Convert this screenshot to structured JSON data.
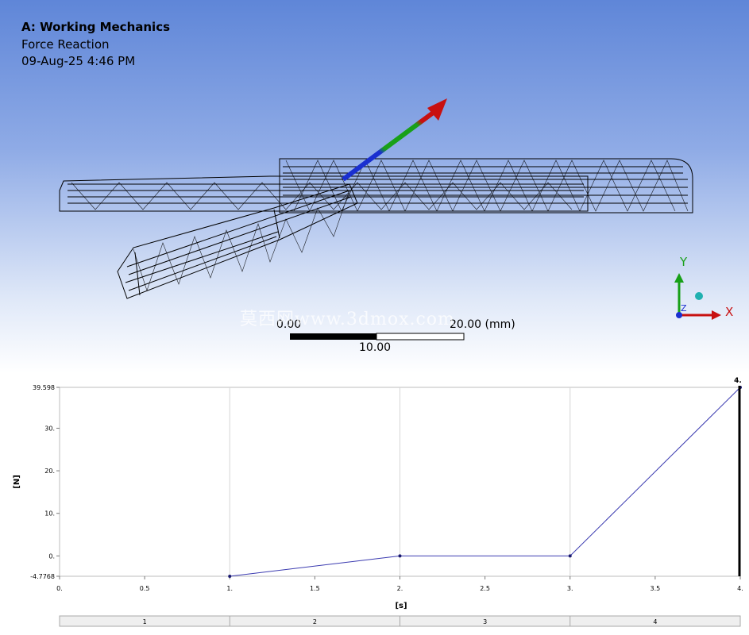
{
  "header": {
    "title": "A: Working Mechanics",
    "subtitle": "Force Reaction",
    "date": "09-Aug-25 4:46 PM"
  },
  "scale_bar": {
    "left_label": "0.00",
    "right_label": "20.00 (mm)",
    "mid_label": "10.00"
  },
  "triad": {
    "y_label": "Y",
    "x_label": "X",
    "z_label": "Z"
  },
  "watermark": "莫西网www.3dmox.com",
  "chart_data": {
    "type": "line",
    "x": [
      1,
      2,
      3,
      4
    ],
    "y": [
      -4.7768,
      0,
      0,
      39.598
    ],
    "xlim": [
      0,
      4
    ],
    "ylim": [
      -4.7768,
      39.598
    ],
    "x_ticks": [
      0,
      0.5,
      1,
      1.5,
      2,
      2.5,
      3,
      3.5,
      4
    ],
    "x_tick_labels": [
      "0.",
      "0.5",
      "1.",
      "1.5",
      "2.",
      "2.5",
      "3.",
      "3.5",
      "4."
    ],
    "y_ticks": [
      -4.7768,
      0,
      10,
      20,
      30,
      39.598
    ],
    "y_tick_labels": [
      "-4.7768",
      "0.",
      "10.",
      "20.",
      "30.",
      "39.598"
    ],
    "xlabel": "[s]",
    "ylabel": "[N]",
    "vertical_grid_at": [
      1,
      2,
      3,
      4
    ],
    "marker_label": "4.",
    "step_bar": [
      "1",
      "2",
      "3",
      "4"
    ],
    "line_color": "#3b3bb0"
  }
}
